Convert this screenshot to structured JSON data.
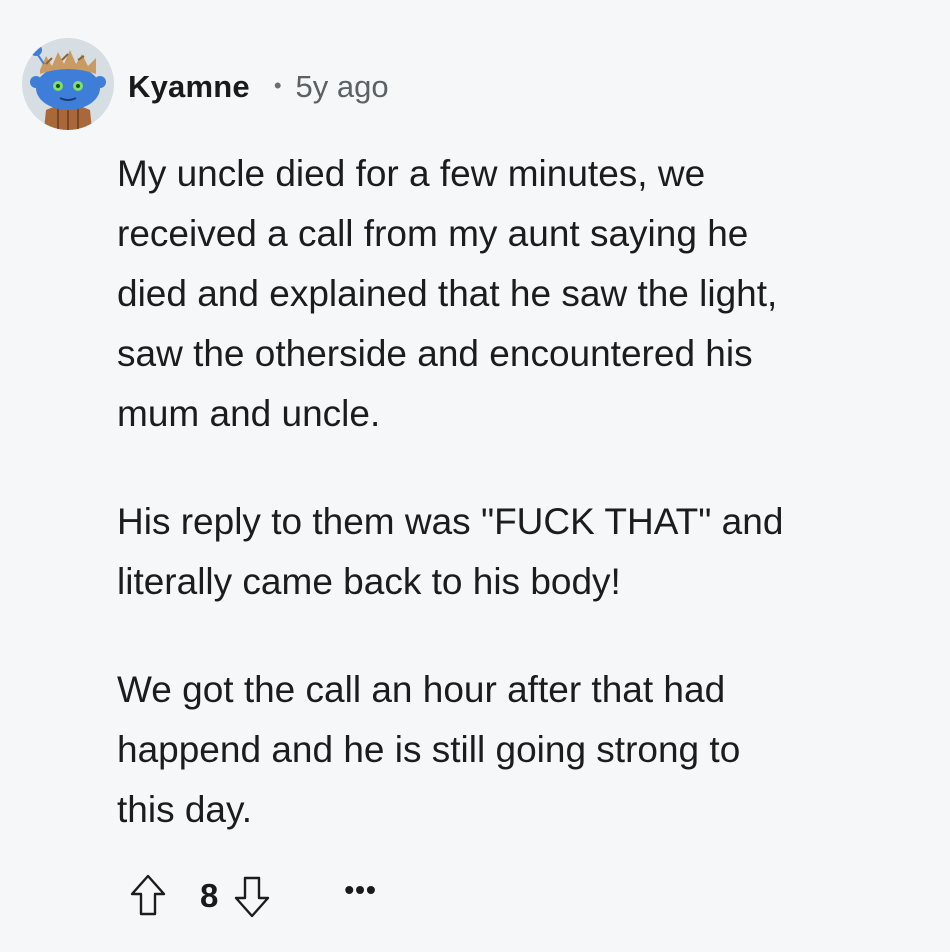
{
  "comment": {
    "username": "Kyamne",
    "separator": "•",
    "time_ago": "5y ago",
    "paragraphs": [
      "My uncle died for a few minutes, we\nreceived a call from my aunt saying he\ndied and explained that he saw the light,\nsaw the otherside and encountered his\nmum and uncle.",
      "His reply to them was \"FUCK THAT\" and\nliterally came back to his body!",
      "We got the call an hour after that had\nhappend and he is still going strong to\nthis day."
    ],
    "votes": {
      "score": "8",
      "upvote_icon": "arrow-up-icon",
      "downvote_icon": "arrow-down-icon"
    },
    "more_label": "•••"
  },
  "colors": {
    "background": "#f6f7f8",
    "text": "#1c1c1c",
    "meta": "#5c6166",
    "avatar_bg": "#d6dde3",
    "snoo_blue": "#3f7ed8"
  }
}
